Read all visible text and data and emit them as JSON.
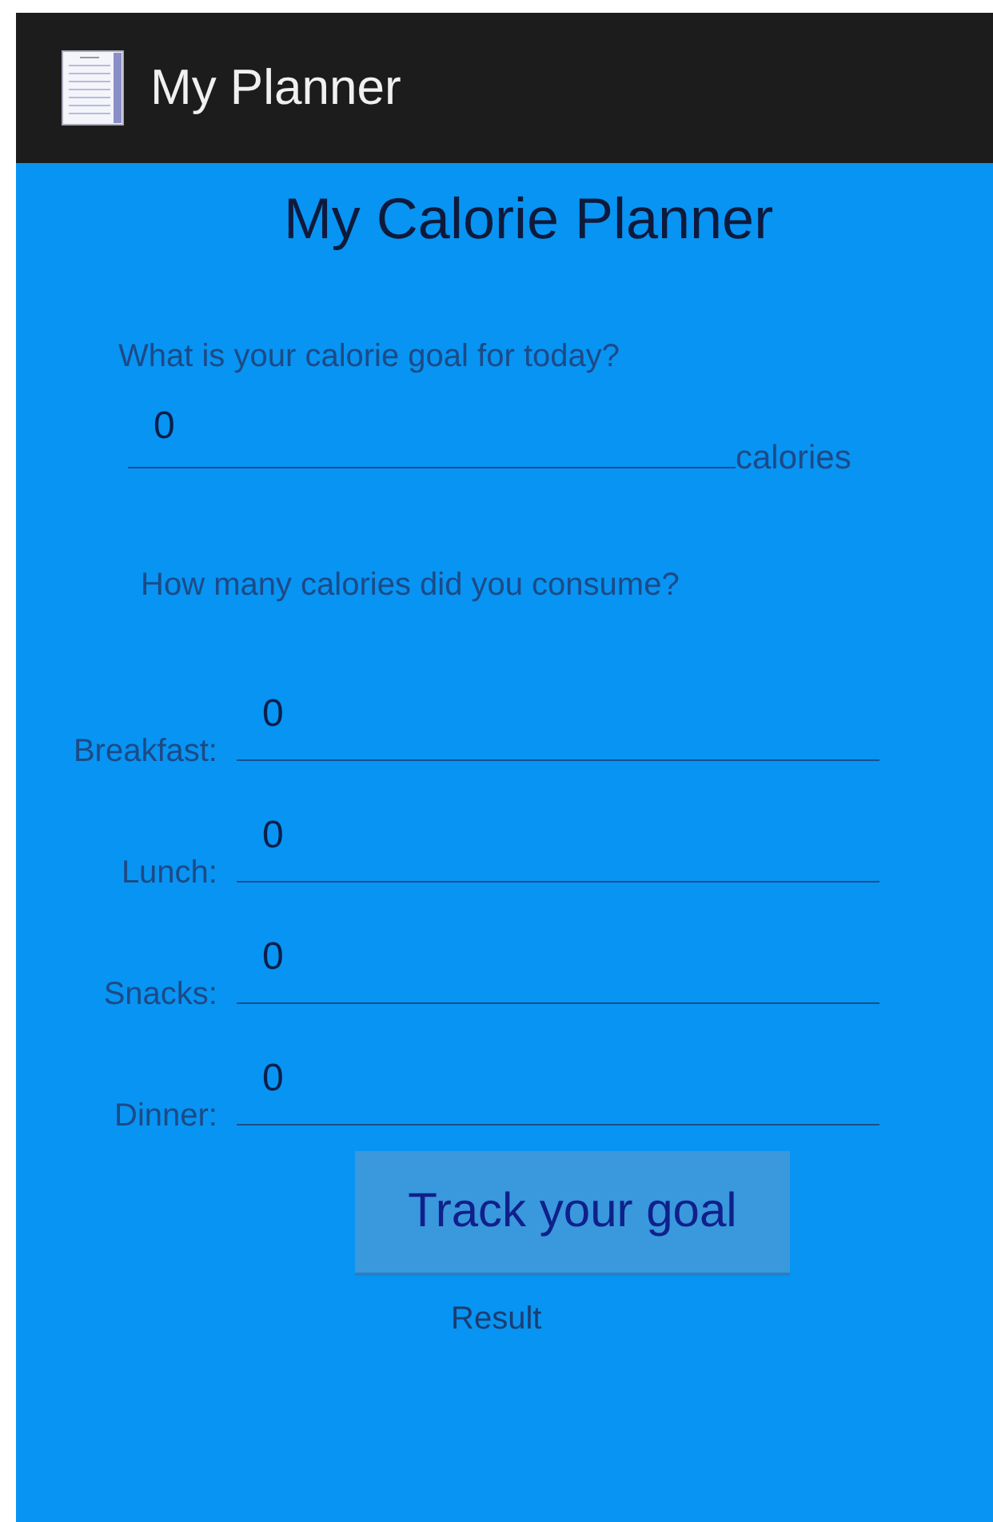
{
  "action_bar": {
    "title": "My Planner"
  },
  "heading": "My Calorie Planner",
  "goal": {
    "question": "What is your calorie goal for today?",
    "value": "0",
    "unit": "calories"
  },
  "consumed": {
    "question": "How many calories did you consume?",
    "meals": [
      {
        "label": "Breakfast:",
        "value": "0"
      },
      {
        "label": "Lunch:",
        "value": "0"
      },
      {
        "label": "Snacks:",
        "value": "0"
      },
      {
        "label": "Dinner:",
        "value": "0"
      }
    ]
  },
  "button": "Track your goal",
  "result": "Result"
}
